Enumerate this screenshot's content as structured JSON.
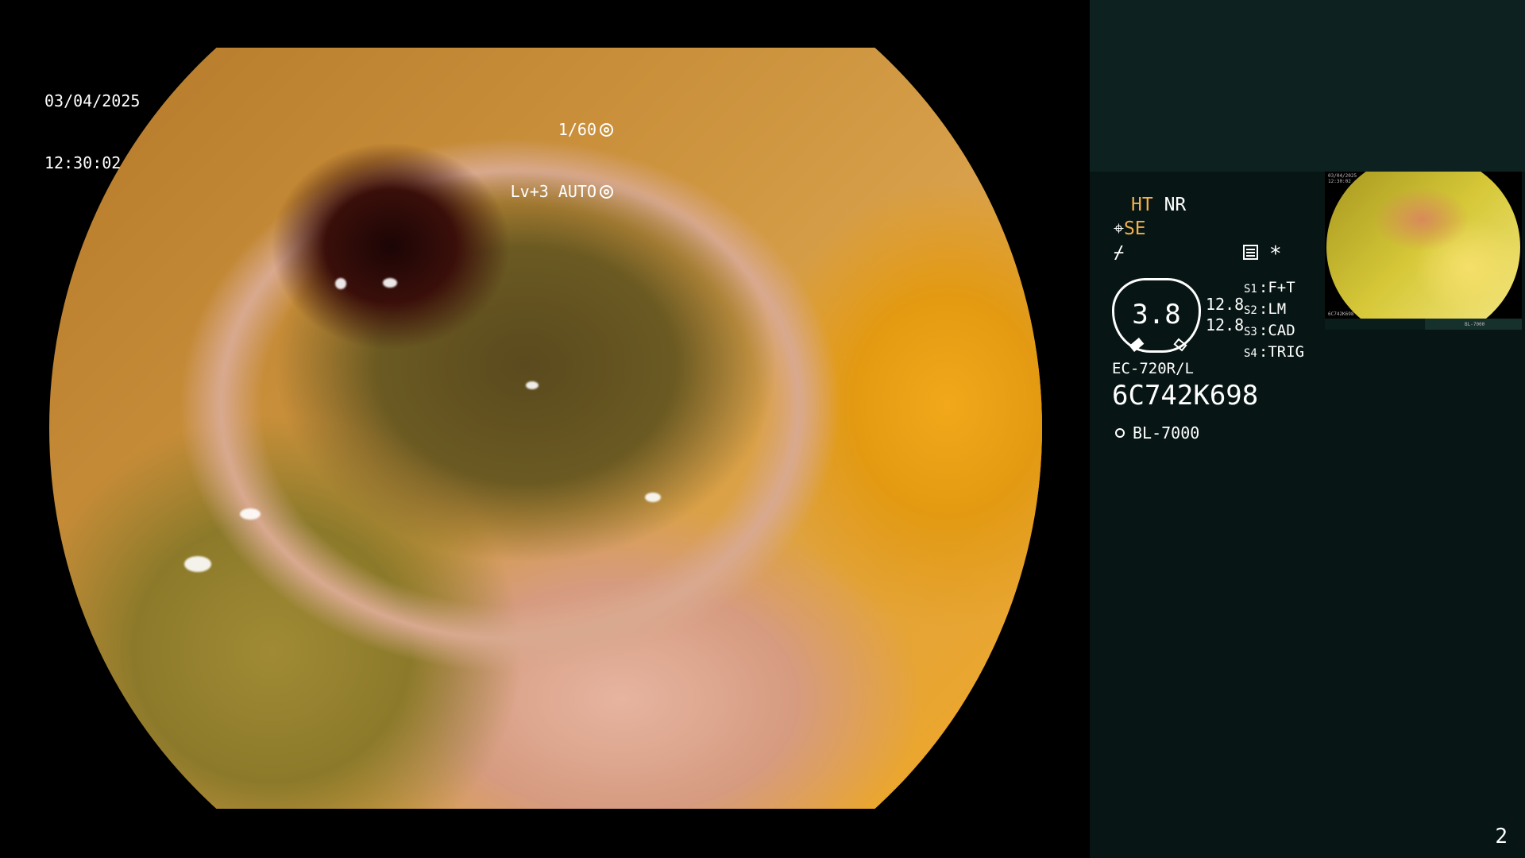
{
  "scope": {
    "date": "03/04/2025",
    "time": "12:30:02",
    "shutter": "1/60",
    "iris": "Lv+3 AUTO"
  },
  "panel": {
    "mode_ht": "HT",
    "mode_nr": "NR",
    "se": "SE",
    "gauge_value": "3.8",
    "gauge_num_1": "12.8",
    "gauge_num_2": "12.8",
    "scenes": [
      {
        "key": "S1",
        "value": "F+T"
      },
      {
        "key": "S2",
        "value": "LM"
      },
      {
        "key": "S3",
        "value": "CAD"
      },
      {
        "key": "S4",
        "value": "TRIG"
      }
    ],
    "scope_model": "EC-720R/L",
    "serial": "6C742K698",
    "light_source": "BL-7000",
    "page_number": "2"
  },
  "thumbnail": {
    "date": "03/04/2025",
    "time": "12:30:02",
    "serial": "6C742K698",
    "light_source": "BL-7000"
  },
  "colors": {
    "panel_bg": "#071614",
    "panel_header_bg": "#0d2220",
    "accent_orange": "#f4b04a"
  },
  "icons": [
    "shutter-icon",
    "auto-iris-icon",
    "structure-enhance-icon",
    "flash-icon",
    "image-memory-icon",
    "asterisk-icon",
    "light-source-icon"
  ]
}
